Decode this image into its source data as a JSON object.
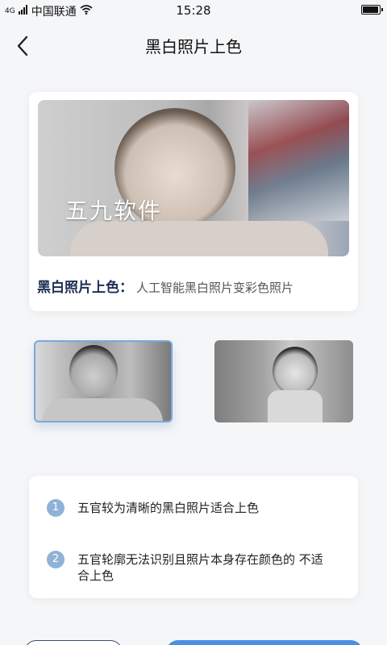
{
  "status_bar": {
    "network": "4G",
    "carrier": "中国联通",
    "time": "15:28"
  },
  "nav": {
    "title": "黑白照片上色"
  },
  "main_card": {
    "watermark": "五九软件",
    "caption_strong": "黑白照片上色：",
    "caption_rest": "人工智能黑白照片变彩色照片"
  },
  "tips": [
    {
      "number": "1",
      "text": "五官较为清晰的黑白照片适合上色"
    },
    {
      "number": "2",
      "text": "五官轮廓无法识别且照片本身存在颜色的 不适合上色"
    }
  ],
  "colors": {
    "accent": "#4a8fe2",
    "caption_strong": "#1d2e54",
    "tip_badge": "#8fb3d7",
    "selected_border": "#7ba7d8"
  }
}
